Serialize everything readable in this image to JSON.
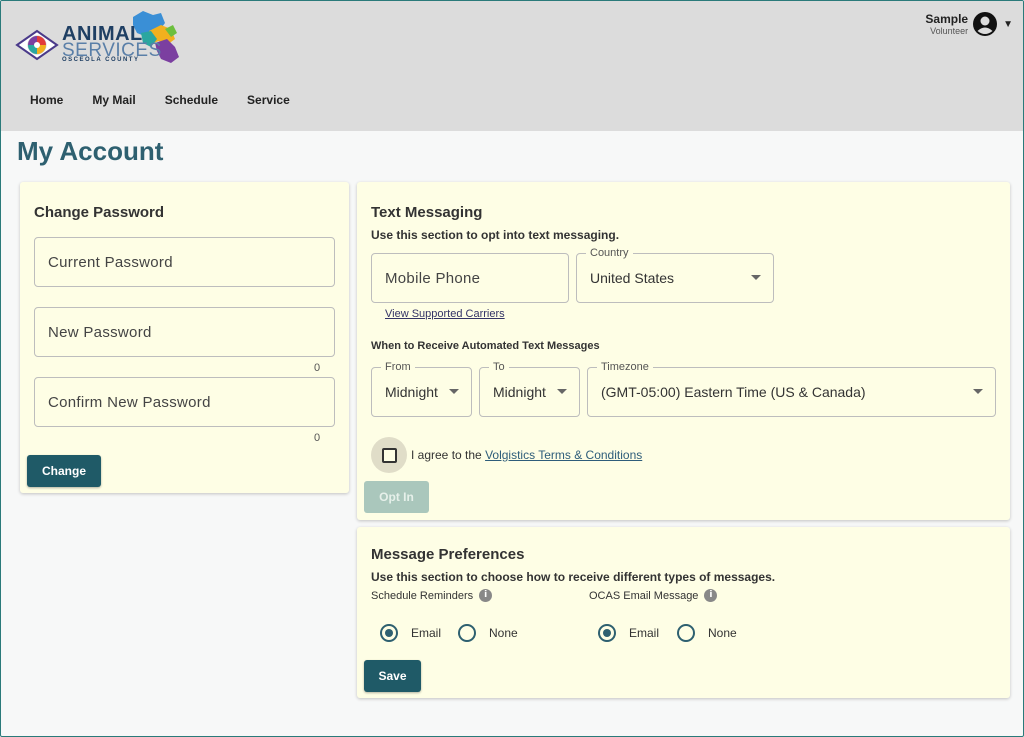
{
  "header": {
    "logo": {
      "line1": "ANIMAL",
      "line2": "SERVICES",
      "line3": "OSCEOLA COUNTY"
    },
    "nav": [
      "Home",
      "My Mail",
      "Schedule",
      "Service"
    ],
    "user": {
      "name": "Sample",
      "role": "Volunteer"
    }
  },
  "page_title": "My Account",
  "change_password": {
    "title": "Change Password",
    "current_placeholder": "Current Password",
    "new_placeholder": "New Password",
    "new_counter": "0",
    "confirm_placeholder": "Confirm New Password",
    "confirm_counter": "0",
    "button": "Change"
  },
  "text_messaging": {
    "title": "Text Messaging",
    "subtitle": "Use this section to opt into text messaging.",
    "phone_placeholder": "Mobile Phone",
    "country_label": "Country",
    "country_value": "United States",
    "carriers_link": "View Supported Carriers",
    "when_label": "When to Receive Automated Text Messages",
    "from_label": "From",
    "from_value": "Midnight",
    "to_label": "To",
    "to_value": "Midnight",
    "timezone_label": "Timezone",
    "timezone_value": "(GMT-05:00) Eastern Time (US & Canada)",
    "agree_prefix": "I agree to the ",
    "agree_link": "Volgistics Terms & Conditions",
    "opt_in_button": "Opt In"
  },
  "message_preferences": {
    "title": "Message Preferences",
    "subtitle": "Use this section to choose how to receive different types of messages.",
    "groups": [
      {
        "label": "Schedule Reminders",
        "options": [
          "Email",
          "None"
        ],
        "selected": "Email"
      },
      {
        "label": "OCAS Email Message",
        "options": [
          "Email",
          "None"
        ],
        "selected": "Email"
      }
    ],
    "save_button": "Save"
  },
  "colors": {
    "header_bg": "#dcdcdc",
    "card_bg": "#fefee5",
    "primary": "#1f5a67",
    "title": "#2e6070"
  }
}
